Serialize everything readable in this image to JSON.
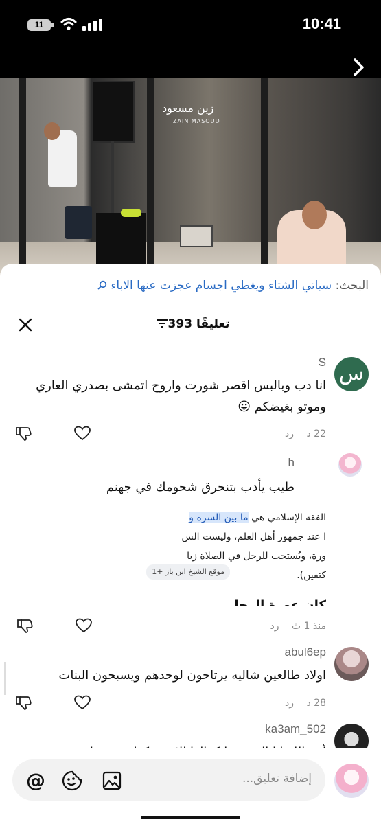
{
  "status_bar": {
    "time": "10:41",
    "battery": "11"
  },
  "video": {
    "watermark": "زين مسعود",
    "watermark_sub": "ZAIN MASOUD"
  },
  "search": {
    "label": "البحث:",
    "query": "سياتي الشتاء ويغطي اجسام عجزت عنها الاباء"
  },
  "header": {
    "count_label": "393 تعليقًا"
  },
  "comments": [
    {
      "username": "S",
      "avatar_letter": "س",
      "text_line1": "انا دب وبالبس اقصر شورت واروح اتمشى بصدري العاري",
      "text_line2": "وموتو بغيضكم 😛",
      "time": "22 د",
      "reply": "رد"
    },
    {
      "username": "h",
      "text": "طيب يأدب بتنحرق شحومك في جهنم",
      "quote": {
        "line1_prefix": "الفقه الإسلامي هي ",
        "line1_highlight": "ما بين السرة و",
        "line2": "ا عند جمهور أهل العلم، وليست الس",
        "line3": "ورة، ويُستحب للرجل في الصلاة زيا",
        "line4": "كتفين).",
        "source": "موقع الشيخ ابن باز +1"
      },
      "cut_heading": "كان عورة الرجل",
      "time": "منذ 1 ث",
      "reply": "رد"
    },
    {
      "username": "abul6ep",
      "text": "اولاد طالعين شاليه يرتاحون لوحدهم ويسبحون البنات",
      "time": "28 د",
      "reply": "رد"
    },
    {
      "username": "ka3am_502",
      "text": "أتق الله انا الزنقة ماتكرالها الا يستبكها حن زنها"
    }
  ],
  "input": {
    "placeholder": "إضافة تعليق..."
  },
  "colors": {
    "accent": "#2a6bc4",
    "avatar_green": "#2f6b4f"
  }
}
